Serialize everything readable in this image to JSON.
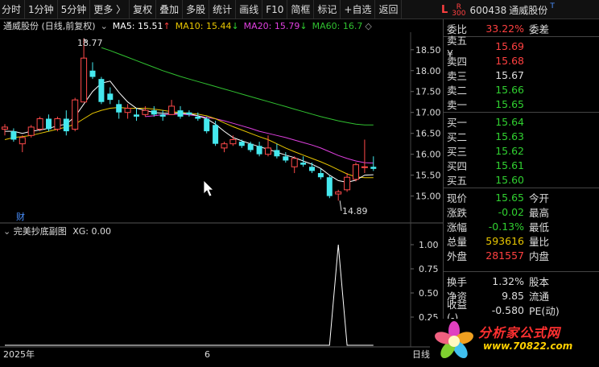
{
  "toolbar": {
    "items": [
      "分时",
      "1分钟",
      "5分钟",
      "更多 〉",
      "复权",
      "叠加",
      "多股",
      "统计",
      "画线",
      "F10",
      "简框",
      "标记",
      "+自选",
      "返回"
    ]
  },
  "stock": {
    "l_badge": "L",
    "r_badge": "R",
    "r_badge_num": "300",
    "code": "600438",
    "name": "通威股份",
    "t_mark": "T"
  },
  "chart_header": {
    "title": "通威股份 (日线,前复权)",
    "ma5": "MA5: 15.51",
    "ma10": "MA10: 15.44",
    "ma20": "MA20: 15.79",
    "ma60": "MA60: 16.7",
    "ma5_arrow": "↑",
    "ma10_arrow": "↓",
    "ma20_arrow": "↓",
    "ma60_arrow": "◇"
  },
  "colors": {
    "up": "#ff4a4a",
    "down": "#45e8ee",
    "ma5": "#ffffff",
    "ma10": "#e8c600",
    "ma20": "#e040e0",
    "ma60": "#30c030",
    "green_text": "#30d030",
    "red_text": "#ff4040",
    "yellow_text": "#e8c600"
  },
  "chart_data": [
    {
      "type": "candlestick",
      "ylim": [
        14.8,
        18.65
      ],
      "yticks": [
        "18.50",
        "18.00",
        "17.50",
        "17.00",
        "16.50",
        "16.00",
        "15.50",
        "15.00"
      ],
      "ytick_values": [
        18.5,
        18.0,
        17.5,
        17.0,
        16.5,
        16.0,
        15.5,
        15.0
      ],
      "annotations": {
        "high_label": "18.77",
        "low_label": "14.89"
      },
      "cai_label": "财",
      "x_labels": [
        "2025年",
        "6"
      ],
      "candles": [
        {
          "o": 16.6,
          "h": 16.72,
          "l": 16.45,
          "c": 16.65
        },
        {
          "o": 16.55,
          "h": 16.62,
          "l": 16.3,
          "c": 16.35
        },
        {
          "o": 16.25,
          "h": 16.45,
          "l": 16.05,
          "c": 16.4
        },
        {
          "o": 16.45,
          "h": 16.7,
          "l": 16.4,
          "c": 16.65
        },
        {
          "o": 16.6,
          "h": 16.9,
          "l": 16.55,
          "c": 16.85
        },
        {
          "o": 16.85,
          "h": 16.95,
          "l": 16.55,
          "c": 16.6
        },
        {
          "o": 16.6,
          "h": 16.9,
          "l": 16.55,
          "c": 16.85
        },
        {
          "o": 16.85,
          "h": 17.05,
          "l": 16.45,
          "c": 16.55
        },
        {
          "o": 16.6,
          "h": 17.35,
          "l": 16.55,
          "c": 17.3
        },
        {
          "o": 17.25,
          "h": 18.77,
          "l": 17.25,
          "c": 18.3
        },
        {
          "o": 18.0,
          "h": 18.2,
          "l": 17.8,
          "c": 17.85
        },
        {
          "o": 17.8,
          "h": 17.85,
          "l": 17.2,
          "c": 17.25
        },
        {
          "o": 17.45,
          "h": 17.6,
          "l": 17.2,
          "c": 17.3
        },
        {
          "o": 17.2,
          "h": 17.3,
          "l": 16.85,
          "c": 17.0
        },
        {
          "o": 17.0,
          "h": 17.2,
          "l": 16.85,
          "c": 17.1
        },
        {
          "o": 16.95,
          "h": 17.1,
          "l": 16.8,
          "c": 16.9
        },
        {
          "o": 16.95,
          "h": 17.15,
          "l": 16.9,
          "c": 17.05
        },
        {
          "o": 17.05,
          "h": 17.15,
          "l": 16.9,
          "c": 16.95
        },
        {
          "o": 16.95,
          "h": 17.05,
          "l": 16.8,
          "c": 16.9
        },
        {
          "o": 16.95,
          "h": 17.3,
          "l": 16.95,
          "c": 17.15
        },
        {
          "o": 17.05,
          "h": 17.15,
          "l": 16.85,
          "c": 16.9
        },
        {
          "o": 17.0,
          "h": 17.05,
          "l": 16.9,
          "c": 16.95
        },
        {
          "o": 16.9,
          "h": 17.0,
          "l": 16.8,
          "c": 16.85
        },
        {
          "o": 16.85,
          "h": 16.9,
          "l": 16.5,
          "c": 16.55
        },
        {
          "o": 16.7,
          "h": 16.8,
          "l": 16.2,
          "c": 16.25
        },
        {
          "o": 16.15,
          "h": 16.3,
          "l": 16.05,
          "c": 16.25
        },
        {
          "o": 16.25,
          "h": 16.45,
          "l": 16.2,
          "c": 16.35
        },
        {
          "o": 16.3,
          "h": 16.35,
          "l": 16.15,
          "c": 16.2
        },
        {
          "o": 16.25,
          "h": 16.3,
          "l": 16.05,
          "c": 16.1
        },
        {
          "o": 16.2,
          "h": 16.3,
          "l": 15.95,
          "c": 16.0
        },
        {
          "o": 16.0,
          "h": 16.45,
          "l": 15.95,
          "c": 16.15
        },
        {
          "o": 16.1,
          "h": 16.25,
          "l": 15.9,
          "c": 15.95
        },
        {
          "o": 15.95,
          "h": 16.05,
          "l": 15.8,
          "c": 15.85
        },
        {
          "o": 15.7,
          "h": 15.95,
          "l": 15.55,
          "c": 15.9
        },
        {
          "o": 15.8,
          "h": 15.95,
          "l": 15.7,
          "c": 15.75
        },
        {
          "o": 15.7,
          "h": 15.8,
          "l": 15.55,
          "c": 15.6
        },
        {
          "o": 15.55,
          "h": 15.65,
          "l": 15.4,
          "c": 15.45
        },
        {
          "o": 15.45,
          "h": 15.5,
          "l": 14.95,
          "c": 15.0
        },
        {
          "o": 15.05,
          "h": 15.15,
          "l": 14.89,
          "c": 15.1
        },
        {
          "o": 15.15,
          "h": 15.55,
          "l": 15.1,
          "c": 15.45
        },
        {
          "o": 15.4,
          "h": 15.8,
          "l": 15.35,
          "c": 15.75
        },
        {
          "o": 15.7,
          "h": 16.35,
          "l": 15.55,
          "c": 15.7
        },
        {
          "o": 15.7,
          "h": 15.95,
          "l": 15.6,
          "c": 15.65
        }
      ],
      "ma5": [
        16.55,
        16.55,
        16.5,
        16.55,
        16.58,
        16.62,
        16.68,
        16.72,
        16.9,
        17.2,
        17.5,
        17.7,
        17.75,
        17.48,
        17.25,
        17.1,
        17.05,
        17.0,
        16.98,
        16.98,
        16.98,
        16.97,
        16.92,
        16.85,
        16.72,
        16.55,
        16.4,
        16.32,
        16.25,
        16.18,
        16.12,
        16.05,
        15.98,
        15.92,
        15.84,
        15.76,
        15.66,
        15.5,
        15.37,
        15.33,
        15.38,
        15.5,
        15.51
      ],
      "ma10": [
        16.35,
        16.4,
        16.42,
        16.45,
        16.5,
        16.55,
        16.6,
        16.65,
        16.72,
        16.85,
        16.98,
        17.05,
        17.1,
        17.12,
        17.1,
        17.1,
        17.1,
        17.08,
        17.05,
        17.02,
        17.0,
        16.98,
        16.96,
        16.92,
        16.85,
        16.75,
        16.66,
        16.58,
        16.5,
        16.42,
        16.35,
        16.25,
        16.15,
        16.06,
        15.98,
        15.9,
        15.82,
        15.73,
        15.63,
        15.53,
        15.46,
        15.44,
        15.44
      ],
      "ma20": [
        null,
        null,
        null,
        null,
        null,
        null,
        null,
        null,
        null,
        null,
        null,
        null,
        null,
        null,
        null,
        null,
        16.9,
        16.92,
        16.95,
        16.95,
        16.96,
        16.94,
        16.92,
        16.88,
        16.85,
        16.8,
        16.74,
        16.68,
        16.62,
        16.55,
        16.5,
        16.45,
        16.4,
        16.34,
        16.28,
        16.22,
        16.15,
        16.06,
        15.97,
        15.9,
        15.84,
        15.8,
        15.79
      ],
      "ma60": [
        null,
        null,
        null,
        null,
        null,
        null,
        null,
        null,
        null,
        null,
        null,
        18.55,
        18.48,
        18.4,
        18.32,
        18.24,
        18.16,
        18.08,
        18.0,
        17.93,
        17.86,
        17.8,
        17.74,
        17.68,
        17.62,
        17.56,
        17.5,
        17.44,
        17.38,
        17.32,
        17.26,
        17.2,
        17.14,
        17.08,
        17.02,
        16.96,
        16.9,
        16.85,
        16.8,
        16.76,
        16.72,
        16.7,
        16.7
      ]
    },
    {
      "type": "line",
      "title": "完美抄底副图",
      "series_label": "XG: 0.00",
      "ylim": [
        0,
        1.1
      ],
      "yticks": [
        "1.00",
        "0.75",
        "0.50",
        "0.25"
      ],
      "ytick_values": [
        1.0,
        0.75,
        0.5,
        0.25
      ],
      "values": [
        0,
        0,
        0,
        0,
        0,
        0,
        0,
        0,
        0,
        0,
        0,
        0,
        0,
        0,
        0,
        0,
        0,
        0,
        0,
        0,
        0,
        0,
        0,
        0,
        0,
        0,
        0,
        0,
        0,
        0,
        0,
        0,
        0,
        0,
        0,
        0,
        0,
        0,
        1,
        0,
        0,
        0,
        0
      ]
    }
  ],
  "axis": {
    "right_suffix": "日线"
  },
  "quote": {
    "weibi_label": "委比",
    "weibi_value": "33.22%",
    "weicha_label": "委差",
    "sells": [
      {
        "label": "卖五 ¥",
        "price": "15.69"
      },
      {
        "label": "卖四",
        "price": "15.68"
      },
      {
        "label": "卖三",
        "price": "15.67"
      },
      {
        "label": "卖二",
        "price": "15.66"
      },
      {
        "label": "卖一",
        "price": "15.65"
      }
    ],
    "buys": [
      {
        "label": "买一",
        "price": "15.64"
      },
      {
        "label": "买二",
        "price": "15.63"
      },
      {
        "label": "买三",
        "price": "15.62"
      },
      {
        "label": "买四",
        "price": "15.61"
      },
      {
        "label": "买五",
        "price": "15.60"
      }
    ],
    "stats": [
      {
        "label": "现价",
        "value": "15.65",
        "extra": "今开"
      },
      {
        "label": "涨跌",
        "value": "-0.02",
        "extra": "最高"
      },
      {
        "label": "涨幅",
        "value": "-0.13%",
        "extra": "最低"
      },
      {
        "label": "总量",
        "value": "593616",
        "extra": "量比"
      },
      {
        "label": "外盘",
        "value": "281557",
        "extra": "内盘"
      }
    ],
    "fin": [
      {
        "label": "换手",
        "value": "1.32%",
        "extra": "股本"
      },
      {
        "label": "净资",
        "value": "9.85",
        "extra": "流通"
      },
      {
        "label": "收益(-)",
        "value": "-0.580",
        "extra": "PE(动)"
      }
    ]
  },
  "logo": {
    "name": "分析家公式网",
    "url": "www.70822.com"
  }
}
